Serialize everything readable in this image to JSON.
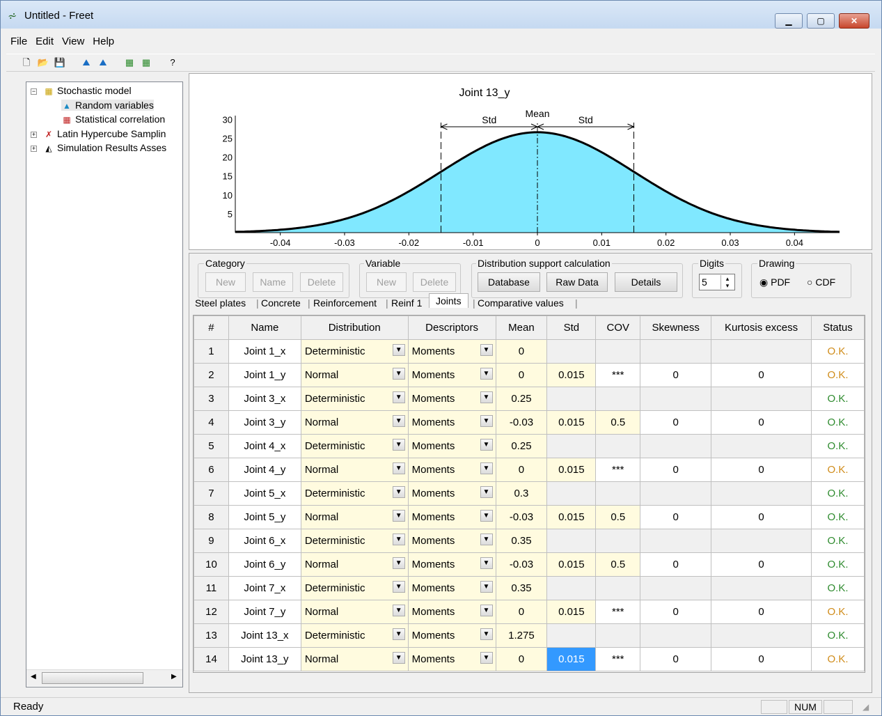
{
  "window": {
    "title": "Untitled - Freet",
    "min": "▁",
    "max": "▢",
    "close": "✕"
  },
  "menu": [
    "File",
    "Edit",
    "View",
    "Help"
  ],
  "toolbar": [
    "new-icon",
    "open-icon",
    "save-icon",
    "chart-icon",
    "chart2-icon",
    "table-icon",
    "table2-icon",
    "help-icon"
  ],
  "tree": {
    "root": "Stochastic model",
    "children": [
      "Random variables",
      "Statistical correlation"
    ],
    "others": [
      "Latin Hypercube Samplin",
      "Simulation Results Asses"
    ]
  },
  "chart_data": {
    "type": "area",
    "title": "Joint 13_y",
    "distribution": "Normal",
    "mean": 0,
    "std": 0.015,
    "x_ticks": [
      -0.04,
      -0.03,
      -0.02,
      -0.01,
      0,
      0.01,
      0.02,
      0.03,
      0.04
    ],
    "x_tick_labels": [
      "-0.04",
      "-0.03",
      "-0.02",
      "-0.01",
      "0",
      "0.01",
      "0.02",
      "0.03",
      "0.04"
    ],
    "y_ticks": [
      5,
      10,
      15,
      20,
      25,
      30
    ],
    "xlim": [
      -0.047,
      0.047
    ],
    "ylim": [
      0,
      31
    ],
    "annotations": {
      "mean": "Mean",
      "std_left": "Std",
      "std_right": "Std"
    },
    "fill": "#80e8ff"
  },
  "category": {
    "label": "Category",
    "new": "New",
    "name": "Name",
    "delete": "Delete"
  },
  "variable": {
    "label": "Variable",
    "new": "New",
    "delete": "Delete"
  },
  "dist_support": {
    "label": "Distribution support calculation",
    "database": "Database",
    "raw": "Raw Data",
    "details": "Details"
  },
  "digits": {
    "label": "Digits",
    "value": "5"
  },
  "drawing": {
    "label": "Drawing",
    "pdf": "PDF",
    "cdf": "CDF"
  },
  "tabs": [
    "Steel plates",
    "Concrete",
    "Reinforcement",
    "Reinf 1",
    "Joints",
    "Comparative values"
  ],
  "table": {
    "headers": [
      "#",
      "Name",
      "Distribution",
      "Descriptors",
      "Mean",
      "Std",
      "COV",
      "Skewness",
      "Kurtosis excess",
      "Status"
    ],
    "rows": [
      [
        "1",
        "Joint 1_x",
        "Deterministic",
        "Moments",
        "0",
        "",
        "",
        "",
        "",
        "O.K."
      ],
      [
        "2",
        "Joint 1_y",
        "Normal",
        "Moments",
        "0",
        "0.015",
        "***",
        "0",
        "0",
        "O.K."
      ],
      [
        "3",
        "Joint 3_x",
        "Deterministic",
        "Moments",
        "0.25",
        "",
        "",
        "",
        "",
        "O.K."
      ],
      [
        "4",
        "Joint 3_y",
        "Normal",
        "Moments",
        "-0.03",
        "0.015",
        "0.5",
        "0",
        "0",
        "O.K."
      ],
      [
        "5",
        "Joint 4_x",
        "Deterministic",
        "Moments",
        "0.25",
        "",
        "",
        "",
        "",
        "O.K."
      ],
      [
        "6",
        "Joint 4_y",
        "Normal",
        "Moments",
        "0",
        "0.015",
        "***",
        "0",
        "0",
        "O.K."
      ],
      [
        "7",
        "Joint 5_x",
        "Deterministic",
        "Moments",
        "0.3",
        "",
        "",
        "",
        "",
        "O.K."
      ],
      [
        "8",
        "Joint 5_y",
        "Normal",
        "Moments",
        "-0.03",
        "0.015",
        "0.5",
        "0",
        "0",
        "O.K."
      ],
      [
        "9",
        "Joint 6_x",
        "Deterministic",
        "Moments",
        "0.35",
        "",
        "",
        "",
        "",
        "O.K."
      ],
      [
        "10",
        "Joint 6_y",
        "Normal",
        "Moments",
        "-0.03",
        "0.015",
        "0.5",
        "0",
        "0",
        "O.K."
      ],
      [
        "11",
        "Joint 7_x",
        "Deterministic",
        "Moments",
        "0.35",
        "",
        "",
        "",
        "",
        "O.K."
      ],
      [
        "12",
        "Joint 7_y",
        "Normal",
        "Moments",
        "0",
        "0.015",
        "***",
        "0",
        "0",
        "O.K."
      ],
      [
        "13",
        "Joint 13_x",
        "Deterministic",
        "Moments",
        "1.275",
        "",
        "",
        "",
        "",
        "O.K."
      ],
      [
        "14",
        "Joint 13_y",
        "Normal",
        "Moments",
        "0",
        "0.015",
        "***",
        "0",
        "0",
        "O.K."
      ]
    ],
    "status_colors": {
      "ok_green": "#2e8b2e",
      "ok_orange": "#d08c1a"
    }
  },
  "status": {
    "text": "Ready",
    "num": "NUM"
  }
}
